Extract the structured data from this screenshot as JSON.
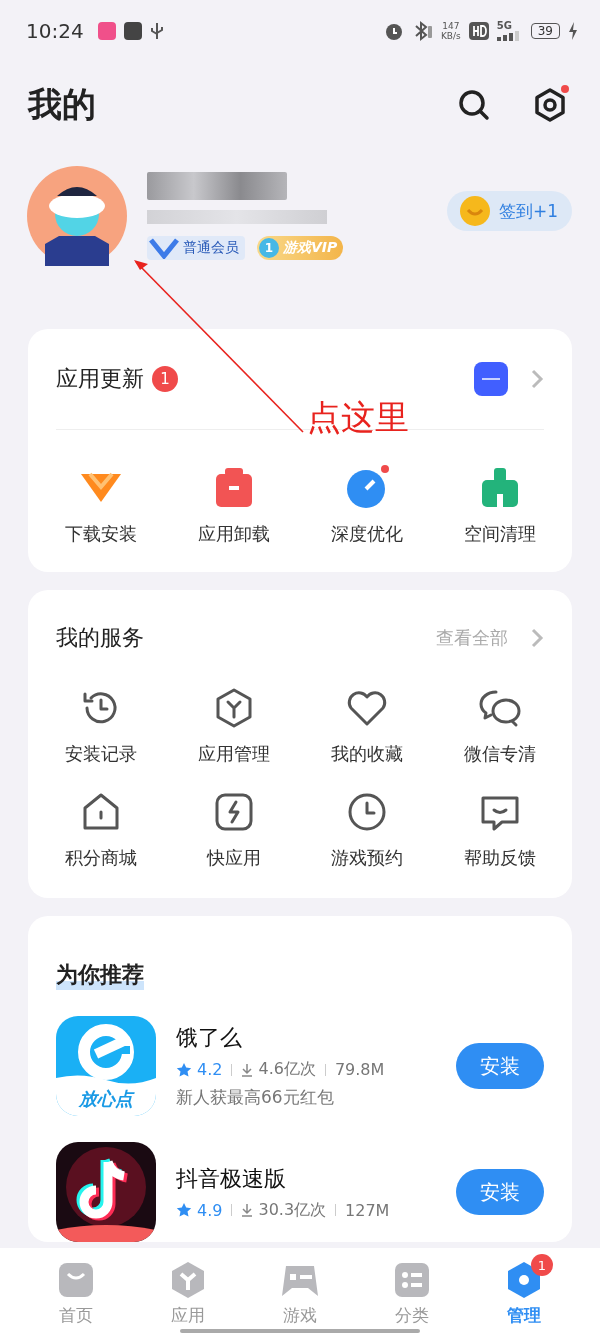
{
  "status_bar": {
    "time": "10:24",
    "net_speed": "147",
    "net_unit": "KB/s",
    "network": "5G",
    "battery": "39"
  },
  "header": {
    "title": "我的"
  },
  "profile": {
    "badges": [
      {
        "kind": "member",
        "label": "普通会员"
      },
      {
        "kind": "vip",
        "level": "1",
        "label": "游戏VIP"
      }
    ],
    "checkin": "签到+1"
  },
  "annotation": {
    "text": "点这里"
  },
  "updates": {
    "title": "应用更新",
    "badge": "1",
    "tools": [
      {
        "kind": "download",
        "label": "下载安装",
        "dot": false
      },
      {
        "kind": "uninstall",
        "label": "应用卸载",
        "dot": false
      },
      {
        "kind": "optimize",
        "label": "深度优化",
        "dot": true
      },
      {
        "kind": "clean",
        "label": "空间清理",
        "dot": false
      }
    ]
  },
  "services": {
    "title": "我的服务",
    "more": "查看全部",
    "items": [
      {
        "kind": "history",
        "label": "安装记录"
      },
      {
        "kind": "manage",
        "label": "应用管理"
      },
      {
        "kind": "heart",
        "label": "我的收藏"
      },
      {
        "kind": "wechat",
        "label": "微信专清"
      },
      {
        "kind": "shop",
        "label": "积分商城"
      },
      {
        "kind": "quick",
        "label": "快应用"
      },
      {
        "kind": "clock",
        "label": "游戏预约"
      },
      {
        "kind": "feedback",
        "label": "帮助反馈"
      }
    ]
  },
  "recommend": {
    "title": "为你推荐",
    "apps": [
      {
        "kind": "eleme",
        "name": "饿了么",
        "caption": "放心点",
        "rating": "4.2",
        "downloads": "4.6亿次",
        "size": "79.8M",
        "desc": "新人获最高66元红包",
        "button": "安装"
      },
      {
        "kind": "douyin",
        "name": "抖音极速版",
        "rating": "4.9",
        "downloads": "30.3亿次",
        "size": "127M",
        "button": "安装"
      }
    ]
  },
  "nav": [
    {
      "kind": "home",
      "label": "首页",
      "selected": false
    },
    {
      "kind": "apps",
      "label": "应用",
      "selected": false
    },
    {
      "kind": "games",
      "label": "游戏",
      "selected": false
    },
    {
      "kind": "category",
      "label": "分类",
      "selected": false
    },
    {
      "kind": "manage",
      "label": "管理",
      "selected": true,
      "badge": "1"
    }
  ]
}
